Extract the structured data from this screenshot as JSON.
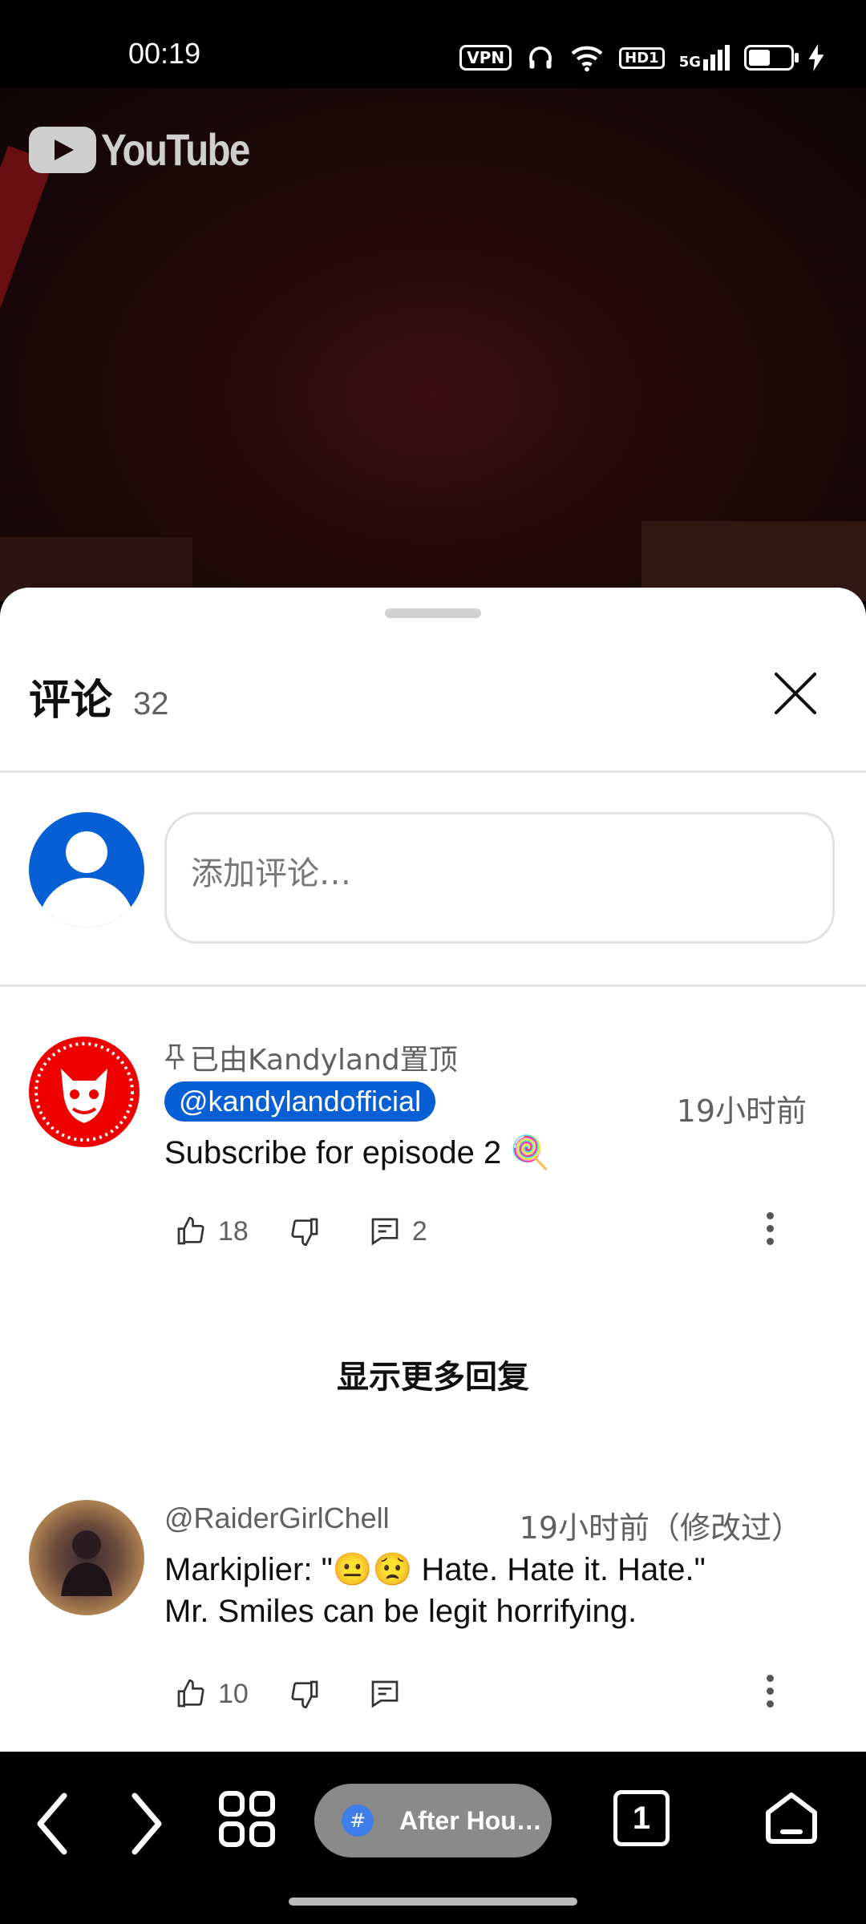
{
  "status_bar": {
    "time": "00:19",
    "vpn_label": "VPN",
    "hd_label": "HD1",
    "network_label": "5G"
  },
  "video": {
    "logo_text": "YouTube"
  },
  "comments_panel": {
    "title": "评论",
    "count": "32",
    "input_placeholder": "添加评论…"
  },
  "comments": [
    {
      "pinned_label": "已由Kandyland置顶",
      "author": "@kandylandofficial",
      "time": "19小时前",
      "text": "Subscribe for episode 2 🍭",
      "likes": "18",
      "replies": "2",
      "avatar_color": "#e50914"
    },
    {
      "author": "@RaiderGirlChell",
      "time": "19小时前（修改过）",
      "text_line1": "Markiplier: \"😐😟 Hate. Hate it. Hate.\"",
      "text_line2": "Mr. Smiles can be legit horrifying.",
      "likes": "10"
    }
  ],
  "show_more_replies": "显示更多回复",
  "bottom_nav": {
    "current_tab_label": "After Hou…",
    "tab_count": "1",
    "tab_favicon": "#"
  },
  "colors": {
    "accent": "#065fd4",
    "text_secondary": "#606060"
  }
}
